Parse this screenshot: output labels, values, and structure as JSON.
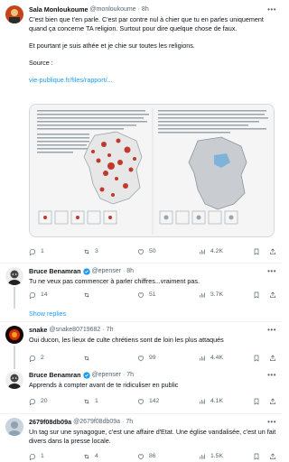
{
  "tweets": [
    {
      "name": "Sala Monloukoume",
      "handle": "@monloukoume",
      "dot": "·",
      "time": "8h",
      "text1": "C'est bien que t'en parle. C'est par contre nul à chier que tu en parles uniquement quand ça concerne TA religion. Surtout pour dire quelque chose de faux.",
      "text2": "Et pourtant je suis athée et je chie sur toutes les religions.",
      "text3": "Source :",
      "link": "vie-publique.fr/files/rapport/...",
      "replies": "1",
      "retweets": "3",
      "likes": "50",
      "views": "4.2K"
    },
    {
      "name": "Bruce Benamran",
      "handle": "@epenser",
      "dot": "·",
      "time": "8h",
      "text": "Tu ne veux pas commencer à parler chiffres...vraiment pas.",
      "replies": "14",
      "retweets": "",
      "likes": "51",
      "views": "3.7K"
    },
    {
      "name": "snake",
      "handle": "@snake80719682",
      "dot": "·",
      "time": "7h",
      "text": "Oui ducon, les lieux de culte chrétiens sont de loin les plus attaqués",
      "replies": "2",
      "retweets": "",
      "likes": "99",
      "views": "4.4K"
    },
    {
      "name": "Bruce Benamran",
      "handle": "@epenser",
      "dot": "·",
      "time": "7h",
      "text": "Apprends à compter avant de te ridiculiser en public",
      "replies": "20",
      "retweets": "1",
      "likes": "142",
      "views": "4.1K"
    },
    {
      "name": "2679f08db09a",
      "handle": "@2679f08db09a",
      "dot": "·",
      "time": "7h",
      "text": "Un tag sur une synagogue, c'est une affaire d'Etat. Une église vandalisée, c'est un fait divers dans la presse locale.",
      "replies": "1",
      "retweets": "4",
      "likes": "86",
      "views": "1.5K"
    }
  ],
  "show_replies": "Show replies",
  "colors": {
    "accent": "#1d9bf0",
    "secondary_text": "#536471",
    "primary_text": "#0f1419",
    "border": "#cfd9de"
  },
  "icons": [
    "more-icon",
    "verified-icon",
    "reply-icon",
    "retweet-icon",
    "like-icon",
    "views-icon",
    "bookmark-icon",
    "share-icon"
  ]
}
